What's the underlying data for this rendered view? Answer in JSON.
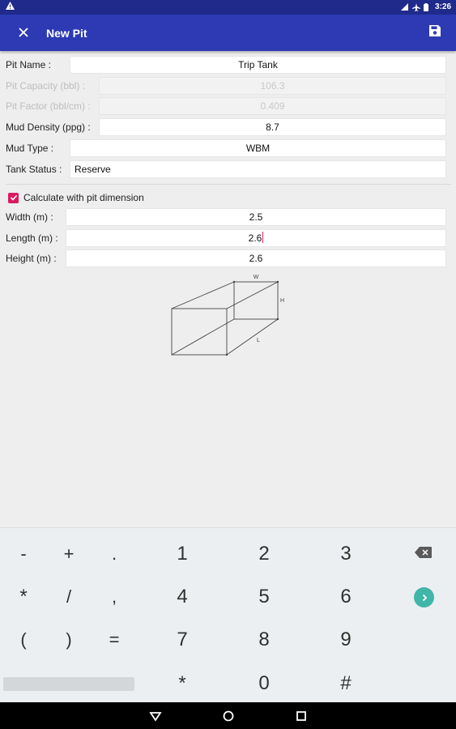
{
  "status_bar": {
    "time": "3:26",
    "icons": [
      "warning-icon",
      "signal-icon",
      "airplane-icon",
      "battery-icon"
    ]
  },
  "app_bar": {
    "title": "New Pit",
    "icons": [
      "close-icon",
      "save-icon"
    ],
    "color": "#2d3ab3"
  },
  "form": {
    "pit_name": {
      "label": "Pit Name :",
      "value": "Trip Tank"
    },
    "pit_capacity": {
      "label": "Pit Capacity (bbl) :",
      "value": "106.3"
    },
    "pit_factor": {
      "label": "Pit Factor (bbl/cm) :",
      "value": "0.409"
    },
    "mud_density": {
      "label": "Mud Density (ppg) :",
      "value": "8.7"
    },
    "mud_type": {
      "label": "Mud Type :",
      "value": "WBM"
    },
    "tank_status": {
      "label": "Tank Status :",
      "value": "Reserve"
    },
    "calc_with_dims": {
      "label": "Calculate with pit dimension",
      "checked": true
    },
    "width": {
      "label": "Width (m) :",
      "value": "2.5"
    },
    "length": {
      "label": "Length (m) :",
      "value": "2.6"
    },
    "height": {
      "label": "Height (m) :",
      "value": "2.6"
    }
  },
  "diagram": {
    "labels": {
      "w": "W",
      "h": "H",
      "l": "L"
    }
  },
  "keyboard": {
    "row1": [
      "-",
      "+",
      ".",
      "1",
      "2",
      "3"
    ],
    "row2": [
      "*",
      "/",
      ",",
      "4",
      "5",
      "6"
    ],
    "row3": [
      "(",
      ")",
      "=",
      "7",
      "8",
      "9"
    ],
    "row4": [
      "*",
      "0",
      "#"
    ],
    "special_icons": [
      "backspace-icon",
      "enter-icon"
    ],
    "accent": "#3fb6a8"
  },
  "nav_bar": {
    "icons": [
      "back-icon",
      "home-icon",
      "recents-icon"
    ]
  },
  "colors": {
    "checkbox": "#d81b60",
    "cursor": "#e0245e"
  }
}
